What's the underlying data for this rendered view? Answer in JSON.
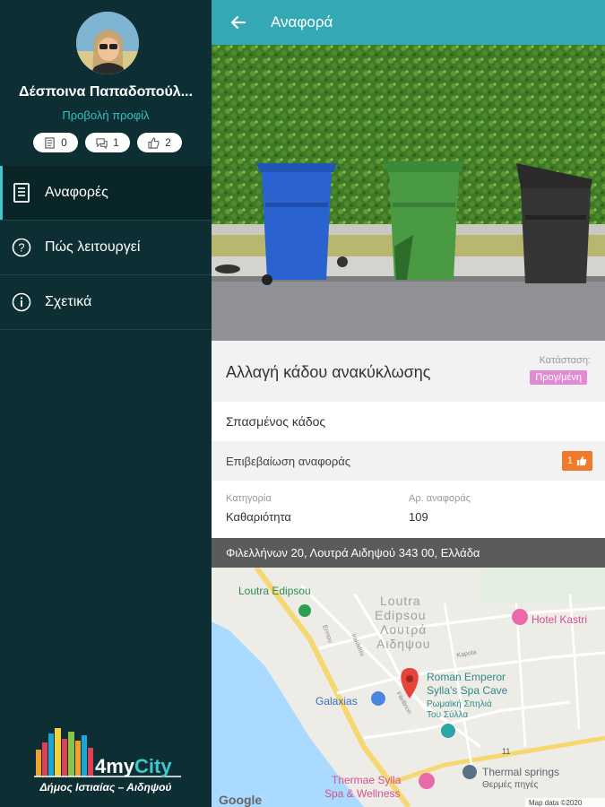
{
  "user": {
    "name": "Δέσποινα Παπαδοπούλ...",
    "profile_link": "Προβολή προφίλ",
    "stats": [
      {
        "icon": "reports-icon",
        "value": "0"
      },
      {
        "icon": "comments-icon",
        "value": "1"
      },
      {
        "icon": "likes-icon",
        "value": "2"
      }
    ]
  },
  "nav": {
    "items": [
      {
        "icon": "document-icon",
        "label": "Αναφορές",
        "active": true
      },
      {
        "icon": "help-circle-icon",
        "label": "Πώς λειτουργεί"
      },
      {
        "icon": "info-circle-icon",
        "label": "Σχετικά"
      }
    ]
  },
  "brand": {
    "logo_text": "4myCity",
    "municipality": "Δήμος Ιστιαίας – Αιδηψού"
  },
  "appbar": {
    "title": "Αναφορά"
  },
  "report": {
    "title": "Αλλαγή κάδου ανακύκλωσης",
    "status_label": "Κατάσταση:",
    "status_value": "Προγ/μένη",
    "description": "Σπασμένος κάδος",
    "confirm_label": "Επιβεβαίωση αναφοράς",
    "confirm_count": "1",
    "category_label": "Κατηγορία",
    "category_value": "Καθαριότητα",
    "number_label": "Αρ. αναφοράς",
    "number_value": "109",
    "address": "Φιλελλήνων 20, Λουτρά Αιδηψού 343 00, Ελλάδα"
  },
  "map": {
    "labels": {
      "loutra_en": "Loutra Edipsou",
      "loutra_big_1": "Loutra",
      "loutra_big_2": "Edipsou",
      "loutra_gr_1": "Λουτρά",
      "loutra_gr_2": "Αιδηψου",
      "hotel": "Hotel Kastri",
      "roman_1": "Roman Emperor",
      "roman_2": "Sylla's Spa Cave",
      "roman_gr_1": "Ρωμαϊκή Σπηλιά",
      "roman_gr_2": "Του Σύλλα",
      "galaxias": "Galaxias",
      "thermae_1": "Thermae Sylla",
      "thermae_2": "Spa & Wellness",
      "thermal_1": "Thermal springs",
      "thermal_2": "Θερμές πηγές",
      "google": "Google",
      "map_data": "Map data ©2020",
      "road_1": "Ermou",
      "road_2": "Iraklidou",
      "road_3": "Filellinon",
      "road_4": "Kapota",
      "route_num": "11"
    }
  },
  "colors": {
    "sidebar_bg": "#0d2f33",
    "appbar_bg": "#35a9b3",
    "accent": "#3fc6cf",
    "status_badge": "#e08bd3",
    "confirm_button": "#f07a2a"
  }
}
